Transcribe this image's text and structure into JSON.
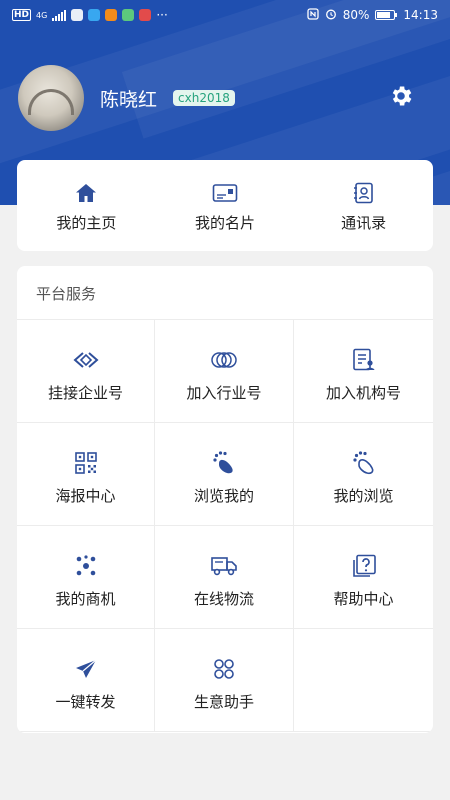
{
  "status_bar": {
    "left_indicators": [
      "HD",
      "4G"
    ],
    "ellipsis": "···",
    "battery": "80%",
    "time": "14:13"
  },
  "profile": {
    "name": "陈晓红",
    "badge": "cxh2018"
  },
  "quick_links": [
    {
      "label": "我的主页",
      "icon": "home-icon"
    },
    {
      "label": "我的名片",
      "icon": "business-card-icon"
    },
    {
      "label": "通讯录",
      "icon": "contacts-icon"
    }
  ],
  "services": {
    "title": "平台服务",
    "items": [
      {
        "label": "挂接企业号",
        "icon": "link-icon"
      },
      {
        "label": "加入行业号",
        "icon": "rings-icon"
      },
      {
        "label": "加入机构号",
        "icon": "org-document-icon"
      },
      {
        "label": "海报中心",
        "icon": "qr-code-icon"
      },
      {
        "label": "浏览我的",
        "icon": "footprint-filled-icon"
      },
      {
        "label": "我的浏览",
        "icon": "footprint-outline-icon"
      },
      {
        "label": "我的商机",
        "icon": "nodes-icon"
      },
      {
        "label": "在线物流",
        "icon": "truck-icon"
      },
      {
        "label": "帮助中心",
        "icon": "help-icon"
      },
      {
        "label": "一键转发",
        "icon": "send-icon"
      },
      {
        "label": "生意助手",
        "icon": "grid-petals-icon"
      }
    ]
  },
  "colors": {
    "header": "#1f4fb0",
    "accent": "#2f4f9b",
    "badge_text": "#27a37e",
    "badge_bg": "#e4f5ee"
  }
}
